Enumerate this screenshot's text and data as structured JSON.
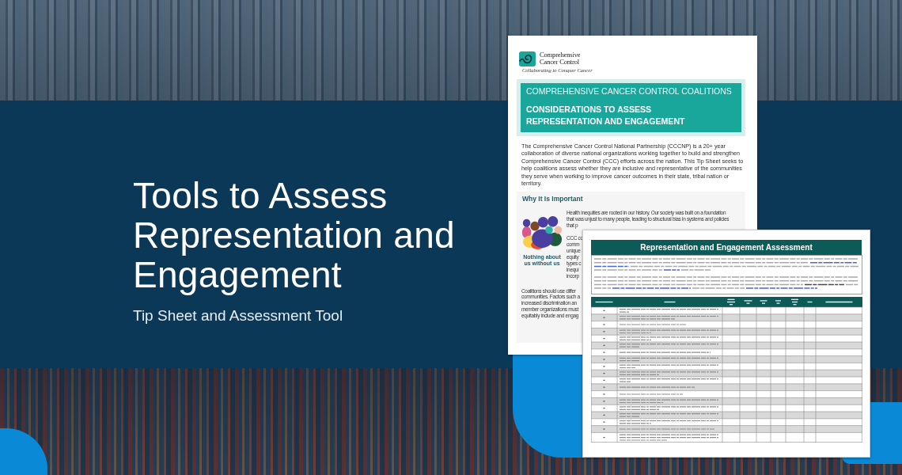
{
  "banner": {
    "title": "Tools to Assess Representation and Engagement",
    "subtitle": "Tip Sheet and Assessment Tool"
  },
  "tip_sheet": {
    "logo": {
      "name": "Comprehensive Cancer Control",
      "tagline": "Collaborating to Conquer Cancer"
    },
    "header": {
      "kicker": "COMPREHENSIVE CANCER CONTROL COALITIONS",
      "title": "CONSIDERATIONS TO ASSESS REPRESENTATION AND ENGAGEMENT"
    },
    "intro_lines": [
      "The Comprehensive Cancer Control National Partnership (CCCNP) is a 20+ year",
      "collaboration of diverse national organizations working together to build and strengthen",
      "Comprehensive Cancer Control (CCC) efforts across the nation. This Tip Sheet seeks to",
      "help coalitions assess whether they are inclusive and representative of the communities",
      "they serve when working to improve cancer outcomes in their state, tribal nation or",
      "territory."
    ],
    "section": {
      "heading": "Why It Is Important",
      "caption": "Nothing about us without us",
      "beside_figure": [
        {
          "lines": [
            "Health inequities are rooted in our history. Our society was built on a foundation",
            "that was unjust to many people, leading to structural bias in systems and policies",
            "that p"
          ]
        },
        {
          "lines": [
            "CCC co",
            "comm",
            "unique",
            "equity",
            "types c",
            "inequi",
            "incorp"
          ]
        }
      ],
      "below": [
        {
          "lines": [
            "Coalitions should use differ",
            "communities. Factors such a",
            "increased discrimination an",
            "member organizations must",
            "equitably include and engag"
          ]
        }
      ]
    }
  },
  "assessment": {
    "title": "Representation and Engagement Assessment"
  }
}
